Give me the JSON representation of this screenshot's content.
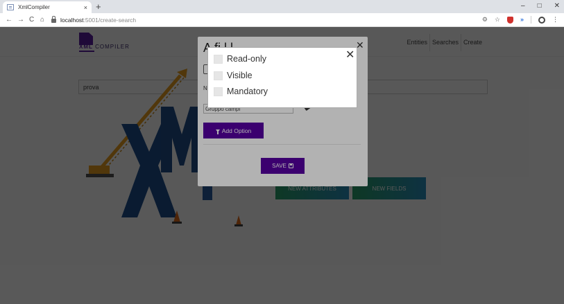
{
  "browser": {
    "tab_title": "XmlCompiler",
    "tab_close": "×",
    "new_tab": "+",
    "url_host": "localhost",
    "url_path": ":5001/create-search",
    "back": "←",
    "forward": "→",
    "reload": "C",
    "home": "⌂",
    "minimize": "–",
    "maximize": "□",
    "close": "✕",
    "star": "☆",
    "more": "⋮"
  },
  "navbar": {
    "logo_text_1": "XML",
    "logo_text_2": " COMPILER",
    "links": [
      "Entities",
      "Searches",
      "Create"
    ]
  },
  "search": {
    "value": "prova"
  },
  "buttons": {
    "new_attributes": "NEW ATTRIBUTES",
    "new_fields": "NEW FIELDS"
  },
  "modal": {
    "title": "A                   fi  l  l",
    "close": "✕",
    "field_label": "N",
    "group_input_value": "Gruppo campi",
    "add_option": "Add Option",
    "save": "SAVE"
  },
  "options_dialog": {
    "close": "✕",
    "options": [
      {
        "label": "Read-only",
        "checked": false
      },
      {
        "label": "Visible",
        "checked": false
      },
      {
        "label": "Mandatory",
        "checked": false
      }
    ]
  },
  "colors": {
    "brand_purple": "#5500a0",
    "green_gradient_start": "#2aa36b",
    "blue_gradient_end": "#2a8fbf",
    "xml_letters": "#1f4f8f",
    "crane": "#e8a020"
  }
}
